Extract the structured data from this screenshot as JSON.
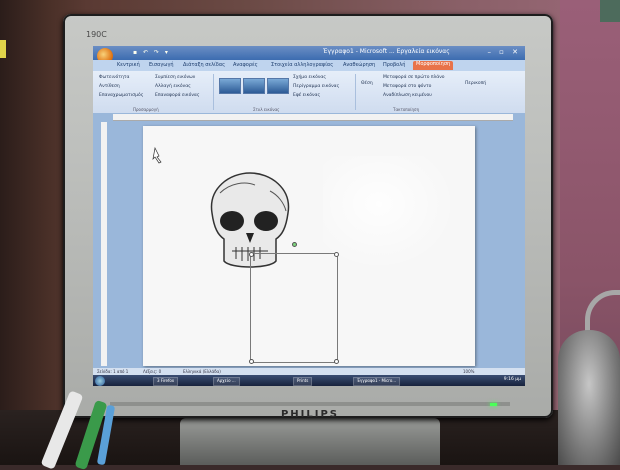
{
  "monitor": {
    "model": "190C",
    "brand": "PHILIPS"
  },
  "window": {
    "title": "Έγγραφο1 - Microsoft ... Εργαλεία εικόνας",
    "office_button_icon": "office-logo-icon",
    "quick_access_icons": [
      "save-icon",
      "undo-icon",
      "redo-icon"
    ],
    "window_controls": [
      "minimize-icon",
      "maximize-icon",
      "close-icon"
    ]
  },
  "ribbon_tabs": [
    {
      "label": "Κεντρική",
      "active": false
    },
    {
      "label": "Εισαγωγή",
      "active": false
    },
    {
      "label": "Διάταξη σελίδας",
      "active": false
    },
    {
      "label": "Αναφορές",
      "active": false
    },
    {
      "label": "Στοιχεία αλληλογραφίας",
      "active": false
    },
    {
      "label": "Αναθεώρηση",
      "active": false
    },
    {
      "label": "Προβολή",
      "active": false
    },
    {
      "label": "Μορφοποίηση",
      "active": true
    }
  ],
  "ribbon": {
    "adjust": {
      "items": [
        "Φωτεινότητα",
        "Αντίθεση",
        "Επαναχρωματισμός",
        "Συμπίεση εικόνων",
        "Αλλαγή εικόνας",
        "Επαναφορά εικόνας"
      ],
      "group": "Προσαρμογή"
    },
    "styles": {
      "group": "Στυλ εικόνας",
      "options": [
        "Σχήμα εικόνας",
        "Περίγραμμα εικόνας",
        "Εφέ εικόνας"
      ]
    },
    "arrange": {
      "group": "Τακτοποίηση",
      "items": [
        "Θέση",
        "Μεταφορά σε πρώτο πλάνο",
        "Μεταφορά στο φόντο",
        "Αναδίπλωση κειμένου"
      ]
    },
    "size": {
      "items": [
        "Περικοπή"
      ]
    }
  },
  "statusbar": {
    "page": "Σελίδα: 1 από 1",
    "words": "Λέξεις: 0",
    "language": "Ελληνικά (Ελλάδα)",
    "zoom": "100%"
  },
  "taskbar": {
    "tasks": [
      "3 Firefox",
      "Αρχείο ...",
      "Prints",
      "Έγγραφο1 - Micro..."
    ],
    "clock": "9:16 μμ"
  }
}
